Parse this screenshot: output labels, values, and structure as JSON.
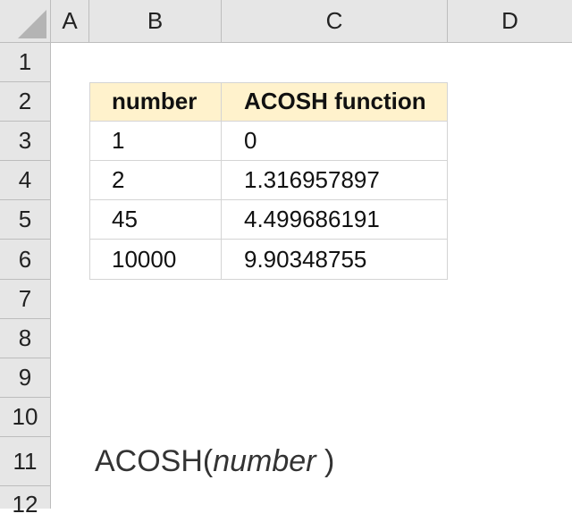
{
  "columns": [
    "A",
    "B",
    "C",
    "D"
  ],
  "rows": [
    "1",
    "2",
    "3",
    "4",
    "5",
    "6",
    "7",
    "8",
    "9",
    "10",
    "11",
    "12"
  ],
  "table": {
    "headers": [
      "number",
      "ACOSH function"
    ],
    "rows": [
      [
        "1",
        "0"
      ],
      [
        "2",
        "1.316957897"
      ],
      [
        "45",
        "4.499686191"
      ],
      [
        "10000",
        "9.90348755"
      ]
    ]
  },
  "syntax": {
    "function_name": "ACOSH(",
    "argument": "number",
    "close": " )"
  },
  "colors": {
    "header_fill": "#fff2cc",
    "grid_header": "#e6e6e6"
  }
}
